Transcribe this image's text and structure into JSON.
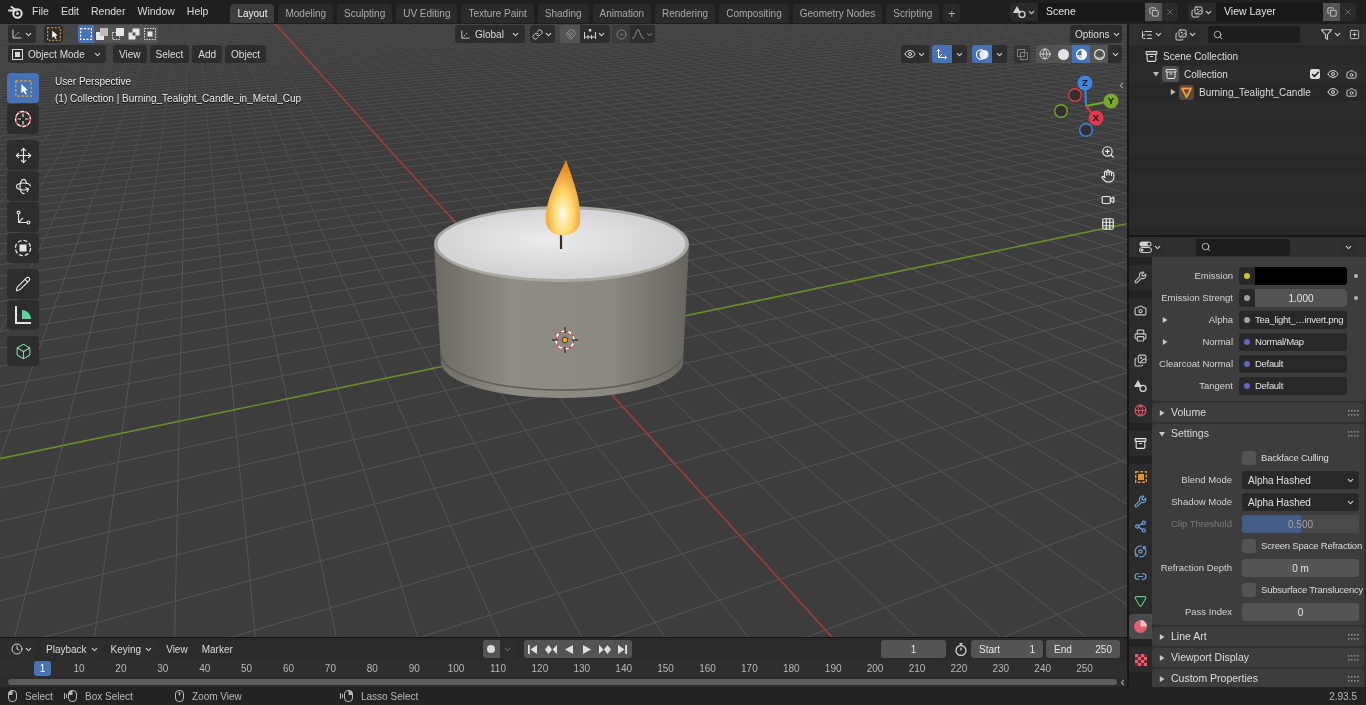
{
  "top_bar": {
    "menus": [
      "File",
      "Edit",
      "Render",
      "Window",
      "Help"
    ],
    "workspaces": [
      {
        "label": "Layout",
        "selected": true
      },
      {
        "label": "Modeling",
        "selected": false
      },
      {
        "label": "Sculpting",
        "selected": false
      },
      {
        "label": "UV Editing",
        "selected": false
      },
      {
        "label": "Texture Paint",
        "selected": false
      },
      {
        "label": "Shading",
        "selected": false
      },
      {
        "label": "Animation",
        "selected": false
      },
      {
        "label": "Rendering",
        "selected": false
      },
      {
        "label": "Compositing",
        "selected": false
      },
      {
        "label": "Geometry Nodes",
        "selected": false
      },
      {
        "label": "Scripting",
        "selected": false
      }
    ],
    "add_workspace": "+",
    "scene": "Scene",
    "view_layer": "View Layer"
  },
  "viewport": {
    "header": {
      "select_modes": [
        {
          "kind": "set",
          "selected": true
        },
        {
          "kind": "extend",
          "selected": false
        },
        {
          "kind": "subtract",
          "selected": false
        },
        {
          "kind": "difference",
          "selected": false
        },
        {
          "kind": "intersect",
          "selected": false
        }
      ],
      "orientation": "Global",
      "options": "Options",
      "mode": "Object Mode",
      "menus": [
        "View",
        "Select",
        "Add",
        "Object"
      ],
      "gizmos": {
        "on": true
      },
      "overlays": {
        "on": true
      },
      "xray": {
        "on": false
      },
      "shading": [
        {
          "kind": "wireframe",
          "selected": false
        },
        {
          "kind": "solid",
          "selected": false
        },
        {
          "kind": "material",
          "selected": true
        },
        {
          "kind": "rendered",
          "selected": false
        }
      ]
    },
    "tools": [
      [
        {
          "kind": "select",
          "selected": true
        },
        {
          "kind": "cursor",
          "selected": false
        }
      ],
      [
        {
          "kind": "move",
          "selected": false
        },
        {
          "kind": "rotate",
          "selected": false
        },
        {
          "kind": "scale",
          "selected": false
        },
        {
          "kind": "transform",
          "selected": false
        }
      ],
      [
        {
          "kind": "annotate",
          "selected": false
        },
        {
          "kind": "measure",
          "selected": false
        }
      ],
      [
        {
          "kind": "add_cube",
          "selected": false
        }
      ]
    ],
    "info": [
      "User Perspective",
      "(1) Collection | Burning_Tealight_Candle_in_Metal_Cup"
    ],
    "gizmo_axes": [
      {
        "kind": "z",
        "label": "Z",
        "color": "#3d86e8"
      },
      {
        "kind": "y",
        "label": "Y",
        "color": "#74a82a"
      },
      {
        "kind": "x",
        "label": "X",
        "color": "#e0384f"
      }
    ]
  },
  "outliner": {
    "tree": [
      {
        "kind": "scene",
        "label": "Scene Collection",
        "children": [
          {
            "kind": "collection",
            "label": "Collection",
            "expanded": true,
            "checked": true,
            "children": [
              {
                "kind": "mesh",
                "label": "Burning_Tealight_Candle",
                "expanded": false
              }
            ]
          }
        ]
      }
    ]
  },
  "properties": {
    "tab_groups": [
      [
        {
          "kind": "tool",
          "selected": false
        }
      ],
      [
        {
          "kind": "render",
          "selected": false
        },
        {
          "kind": "output",
          "selected": false
        },
        {
          "kind": "view_layer",
          "selected": false
        },
        {
          "kind": "scene",
          "selected": false
        },
        {
          "kind": "world",
          "selected": false
        }
      ],
      [
        {
          "kind": "collection",
          "selected": false
        }
      ],
      [
        {
          "kind": "object",
          "selected": false
        },
        {
          "kind": "modifiers",
          "selected": false
        },
        {
          "kind": "particles",
          "selected": false
        },
        {
          "kind": "physics",
          "selected": false
        },
        {
          "kind": "constraints",
          "selected": false
        },
        {
          "kind": "data",
          "selected": false
        },
        {
          "kind": "material",
          "selected": true
        }
      ],
      [
        {
          "kind": "texture",
          "selected": false
        }
      ]
    ],
    "inputs": [
      {
        "kind": "color",
        "label": "Emission",
        "color": "#c7c729",
        "keyframe": true
      },
      {
        "kind": "number",
        "label": "Emission Strengt",
        "color": "#a1a1a1",
        "value": "1.000",
        "keyframe": true
      },
      {
        "kind": "link",
        "label": "Alpha",
        "color": "#a1a1a1",
        "value": "Tea_light_…invert.png",
        "expanded": false
      },
      {
        "kind": "link",
        "label": "Normal",
        "color": "#6363c7",
        "value": "Normal/Map",
        "expanded": false
      },
      {
        "kind": "link",
        "label": "Clearcoat Normal",
        "color": "#6363c7",
        "value": "Default"
      },
      {
        "kind": "link",
        "label": "Tangent",
        "color": "#6363c7",
        "value": "Default"
      }
    ],
    "panels": [
      {
        "label": "Volume",
        "expanded": false
      },
      {
        "label": "Settings",
        "expanded": true,
        "rows": [
          {
            "kind": "checkbox",
            "label": "Backface Culling",
            "checked": false
          },
          {
            "kind": "dropdown",
            "label": "Blend Mode",
            "value": "Alpha Hashed"
          },
          {
            "kind": "dropdown",
            "label": "Shadow Mode",
            "value": "Alpha Hashed"
          },
          {
            "kind": "slider",
            "label": "Clip Threshold",
            "value": "0.500",
            "level": 0.5,
            "disabled": true
          },
          {
            "kind": "checkbox",
            "label": "Screen Space Refraction",
            "checked": false
          },
          {
            "kind": "number",
            "label": "Refraction Depth",
            "value": "0 m"
          },
          {
            "kind": "checkbox",
            "label": "Subsurface Translucency",
            "checked": false
          },
          {
            "kind": "number",
            "label": "Pass Index",
            "value": "0"
          }
        ]
      },
      {
        "label": "Line Art",
        "expanded": false
      },
      {
        "label": "Viewport Display",
        "expanded": false
      },
      {
        "label": "Custom Properties",
        "expanded": false
      }
    ]
  },
  "timeline": {
    "menus": [
      {
        "kind": "dropdown",
        "label": "Playback"
      },
      {
        "kind": "dropdown",
        "label": "Keying"
      },
      {
        "kind": "plain",
        "label": "View"
      },
      {
        "kind": "plain",
        "label": "Marker"
      }
    ],
    "auto_key": {
      "on": false
    },
    "transport": [
      {
        "kind": "jump_start"
      },
      {
        "kind": "prev_key"
      },
      {
        "kind": "play_reverse"
      },
      {
        "kind": "play"
      },
      {
        "kind": "next_key"
      },
      {
        "kind": "jump_end"
      }
    ],
    "current_frame": "1",
    "start": {
      "label": "Start",
      "value": "1"
    },
    "end": {
      "label": "End",
      "value": "250"
    },
    "ruler": {
      "current": "1",
      "labels": [
        "10",
        "20",
        "30",
        "40",
        "50",
        "60",
        "70",
        "80",
        "90",
        "100",
        "110",
        "120",
        "130",
        "140",
        "150",
        "160",
        "170",
        "180",
        "190",
        "200",
        "210",
        "220",
        "230",
        "240",
        "250"
      ]
    }
  },
  "status_bar": {
    "hints": [
      {
        "kind": "left",
        "label": "Select"
      },
      {
        "kind": "left_drag",
        "label": "Box Select"
      },
      {
        "kind": "middle",
        "label": "Zoom View"
      },
      {
        "kind": "right_drag",
        "label": "Lasso Select"
      }
    ],
    "version": "2.93.5"
  }
}
